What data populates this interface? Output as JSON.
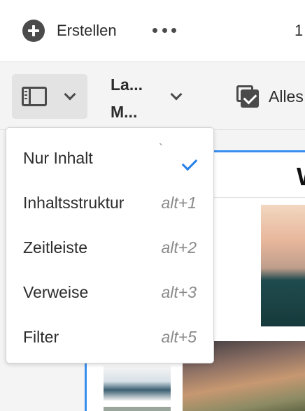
{
  "header": {
    "create_label": "Erstellen",
    "count_text": "1"
  },
  "toolbar": {
    "layout_label": "La...\nM...",
    "select_all_label": "Alles"
  },
  "content": {
    "card_title": "W"
  },
  "menu": {
    "items": [
      {
        "label": "Nur Inhalt",
        "shortcut": "`",
        "selected": true
      },
      {
        "label": "Inhaltsstruktur",
        "shortcut": "alt+1",
        "selected": false
      },
      {
        "label": "Zeitleiste",
        "shortcut": "alt+2",
        "selected": false
      },
      {
        "label": "Verweise",
        "shortcut": "alt+3",
        "selected": false
      },
      {
        "label": "Filter",
        "shortcut": "alt+5",
        "selected": false
      }
    ]
  },
  "colors": {
    "accent": "#2680eb",
    "selection_border": "#378ef0"
  },
  "icons": [
    "plus-circle-icon",
    "more-icon",
    "panel-icon",
    "chevron-down-icon",
    "select-all-icon",
    "checkmark-icon"
  ]
}
